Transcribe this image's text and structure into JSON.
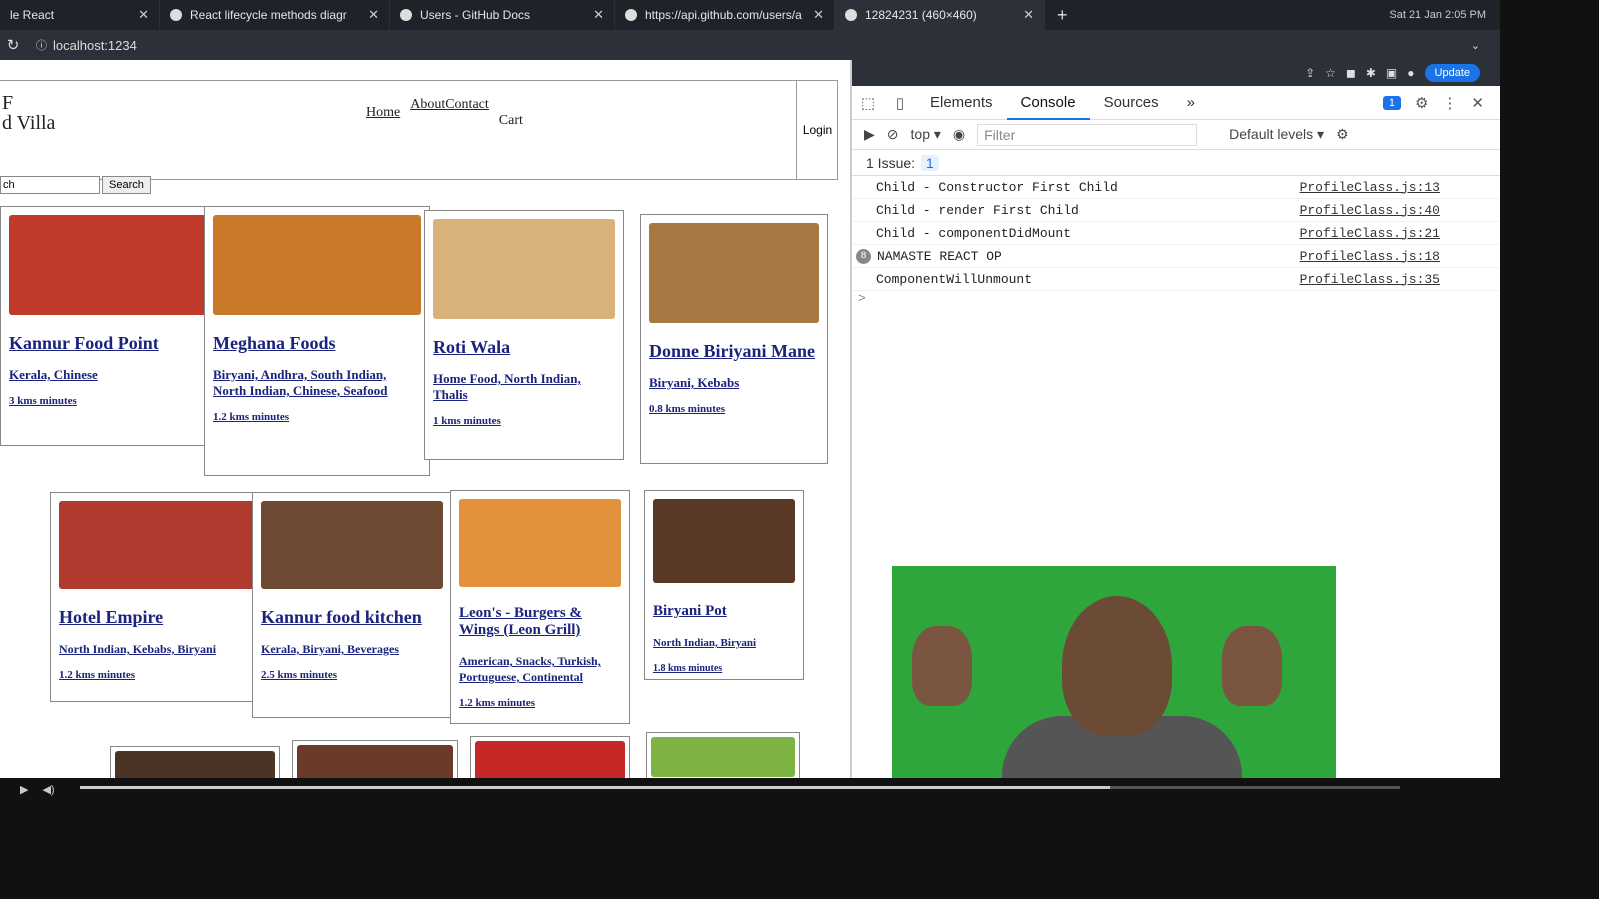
{
  "browser": {
    "tabs": [
      {
        "label": "le React",
        "active": false
      },
      {
        "label": "React lifecycle methods diagr",
        "active": false
      },
      {
        "label": "Users - GitHub Docs",
        "active": false
      },
      {
        "label": "https://api.github.com/users/a",
        "active": false
      },
      {
        "label": "12824231 (460×460)",
        "active": true
      }
    ],
    "clock": "Sat 21 Jan  2:05 PM",
    "url": "localhost:1234"
  },
  "app": {
    "logo_line1": "F",
    "logo_line2": "d Villa",
    "nav": {
      "home": "Home",
      "about": "About",
      "contact": "Contact",
      "cart": "Cart"
    },
    "login": "Login",
    "search": {
      "value": "ch",
      "button": "Search"
    },
    "cards": [
      {
        "name": "Kannur Food Point",
        "cuisines": "Kerala, Chinese",
        "distance": "3 kms minutes",
        "color": "#c0392b"
      },
      {
        "name": "Meghana Foods",
        "cuisines": "Biryani, Andhra, South Indian, North Indian, Chinese, Seafood",
        "distance": "1.2 kms minutes",
        "color": "#c87a2a"
      },
      {
        "name": "Roti Wala",
        "cuisines": "Home Food, North Indian, Thalis",
        "distance": "1 kms minutes",
        "color": "#d9b27c"
      },
      {
        "name": "Donne Biriyani Mane",
        "cuisines": "Biryani, Kebabs",
        "distance": "0.8 kms minutes",
        "color": "#a87843"
      },
      {
        "name": "Hotel Empire",
        "cuisines": "North Indian, Kebabs, Biryani",
        "distance": "1.2 kms minutes",
        "color": "#b03a2e"
      },
      {
        "name": "Kannur food kitchen",
        "cuisines": "Kerala, Biryani, Beverages",
        "distance": "2.5 kms minutes",
        "color": "#6e4a32"
      },
      {
        "name": "Leon's - Burgers & Wings (Leon Grill)",
        "cuisines": "American, Snacks, Turkish, Portuguese, Continental",
        "distance": "1.2 kms minutes",
        "color": "#e0913a"
      },
      {
        "name": "Biryani Pot",
        "cuisines": "North Indian, Biryani",
        "distance": "1.8 kms minutes",
        "color": "#5a3a26"
      }
    ]
  },
  "devtools": {
    "update": "Update",
    "tabs": [
      "Elements",
      "Console",
      "Sources"
    ],
    "more": "»",
    "msg_count": "1",
    "context": "top",
    "filter_placeholder": "Filter",
    "levels": "Default levels",
    "issues_label": "1 Issue:",
    "issues_count": "1",
    "logs": [
      {
        "text": "Child - Constructor First Child",
        "src": "ProfileClass.js:13",
        "count": ""
      },
      {
        "text": "Child - render First Child",
        "src": "ProfileClass.js:40",
        "count": ""
      },
      {
        "text": "Child - componentDidMount",
        "src": "ProfileClass.js:21",
        "count": ""
      },
      {
        "text": "NAMASTE REACT OP",
        "src": "ProfileClass.js:18",
        "count": "8"
      },
      {
        "text": "ComponentWillUnmount",
        "src": "ProfileClass.js:35",
        "count": ""
      }
    ],
    "prompt": ">"
  },
  "video": {
    "progress": 0.78
  }
}
